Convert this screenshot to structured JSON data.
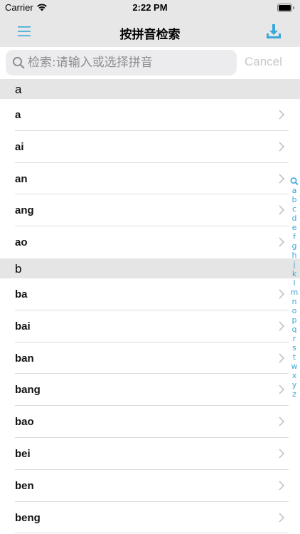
{
  "status_bar": {
    "carrier": "Carrier",
    "time": "2:22 PM"
  },
  "nav": {
    "title": "按拼音检索",
    "menu_icon": "menu-icon",
    "download_icon": "download-icon",
    "accent_color": "#3aa7d9"
  },
  "search": {
    "placeholder": "检索:请输入或选择拼音",
    "cancel_label": "Cancel"
  },
  "sections": [
    {
      "header": "a",
      "items": [
        "a",
        "ai",
        "an",
        "ang",
        "ao"
      ]
    },
    {
      "header": "b",
      "items": [
        "ba",
        "bai",
        "ban",
        "bang",
        "bao",
        "bei",
        "ben",
        "beng"
      ]
    }
  ],
  "index_letters": [
    "a",
    "b",
    "c",
    "d",
    "e",
    "f",
    "g",
    "h",
    "j",
    "k",
    "l",
    "m",
    "n",
    "o",
    "p",
    "q",
    "r",
    "s",
    "t",
    "w",
    "x",
    "y",
    "z"
  ]
}
